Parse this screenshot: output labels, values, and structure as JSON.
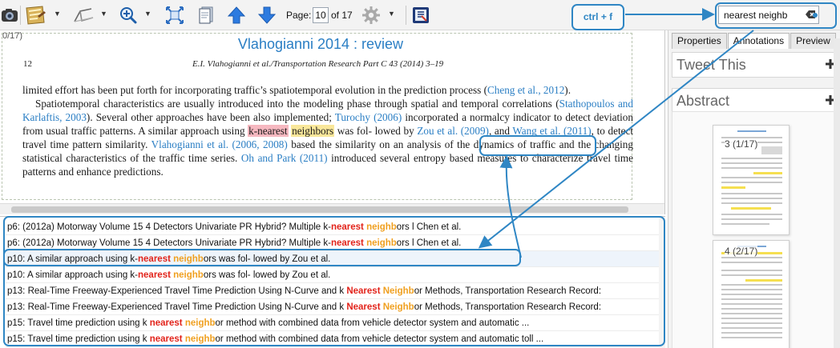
{
  "toolbar": {
    "page_label": "Page:",
    "page_value": "10",
    "page_of": "of 17",
    "search_value": "nearest neighb",
    "icons": [
      "camera-icon",
      "notes-icon",
      "highlighter-icon",
      "zoom-icon",
      "fit-page-icon",
      "page-icon",
      "arrow-up-icon",
      "arrow-down-icon",
      "settings-icon",
      "scan-icon",
      "clear-icon"
    ]
  },
  "document": {
    "page_position": "0/17)",
    "title": "Vlahogianni 2014 : review",
    "page_number": "12",
    "running_head": "E.I. Vlahogianni et al./Transportation Research Part C 43 (2014) 3–19",
    "para1": {
      "t1": "limited effort has been put forth for incorporating traffic’s spatiotemporal evolution in the prediction process (",
      "c1": "Cheng et al., 2012",
      "t2": ")."
    },
    "para2": {
      "t1": "Spatiotemporal characteristics are usually introduced into the modeling phase through spatial and temporal correlations (",
      "c1": "Stathopoulos and Karlaftis, 2003",
      "t2": "). Several other approaches have been also implemented; ",
      "c2": "Turochy (2006)",
      "t3": " incorporated a normalcy indicator to detect deviation from usual traffic patterns. A similar approach using ",
      "h1": "k-nearest",
      "t4": " ",
      "h2": "neighbors",
      "t5": " was fol- lowed by ",
      "c3": "Zou et al. (2009)",
      "t6": ", and ",
      "c4": "Wang et al. (2011)",
      "t7": ", to detect travel time pattern similarity. ",
      "c5": "Vlahogianni et al. (2006, 2008)",
      "t8": " based the similarity on an analysis of the dynamics of traffic and the changing statistical characteristics of the traffic time series. ",
      "c6": "Oh and Park (2011)",
      "t9": " introduced several entropy based measures to characterize travel time patterns and enhance predictions."
    }
  },
  "results": [
    {
      "prefix": "p6: (2012a) Motorway Volume 15 4 Detectors Univariate PR Hybrid? Multiple k-",
      "k1": "nearest",
      "sp": " ",
      "k2": "neighb",
      "suffix": "ors l Chen et al."
    },
    {
      "prefix": "p6: (2012a) Motorway Volume 15 4 Detectors Univariate PR Hybrid? Multiple k-",
      "k1": "nearest",
      "sp": " ",
      "k2": "neighb",
      "suffix": "ors l Chen et al."
    },
    {
      "prefix": "p10: A similar approach using k-",
      "k1": "nearest",
      "sp": " ",
      "k2": "neighb",
      "suffix": "ors was fol- lowed by Zou et al."
    },
    {
      "prefix": "p10: A similar approach using k-",
      "k1": "nearest",
      "sp": " ",
      "k2": "neighb",
      "suffix": "ors was fol- lowed by Zou et al."
    },
    {
      "prefix": "p13: Real-Time Freeway-Experienced Travel Time Prediction Using N-Curve and k ",
      "k1": "Nearest",
      "sp": " ",
      "k2": "Neighb",
      "suffix": "or Methods, Transportation Research Record:"
    },
    {
      "prefix": "p13: Real-Time Freeway-Experienced Travel Time Prediction Using N-Curve and k ",
      "k1": "Nearest",
      "sp": " ",
      "k2": "Neighb",
      "suffix": "or Methods, Transportation Research Record:"
    },
    {
      "prefix": "p15: Travel time prediction using k ",
      "k1": "nearest",
      "sp": " ",
      "k2": "neighb",
      "suffix": "or method with combined data from vehicle detector system and automatic ..."
    },
    {
      "prefix": "p15: Travel time prediction using k ",
      "k1": "nearest",
      "sp": " ",
      "k2": "neighb",
      "suffix": "or method with combined data from vehicle detector system and automatic toll ..."
    }
  ],
  "right_panel": {
    "tabs": [
      "Properties",
      "Annotations",
      "Preview"
    ],
    "sections": [
      "Tweet This",
      "Abstract"
    ],
    "thumbnails": [
      "3 (1/17)",
      "4 (2/17)"
    ]
  },
  "annotation": {
    "shortcut_label": "ctrl + f"
  },
  "colors": {
    "accent": "#2f86c4",
    "link": "#2a7ec4",
    "keyword_primary": "#e2231a",
    "keyword_secondary": "#f0a020",
    "highlight_current": "#f6b8c0",
    "highlight_other": "#f9e79a"
  }
}
